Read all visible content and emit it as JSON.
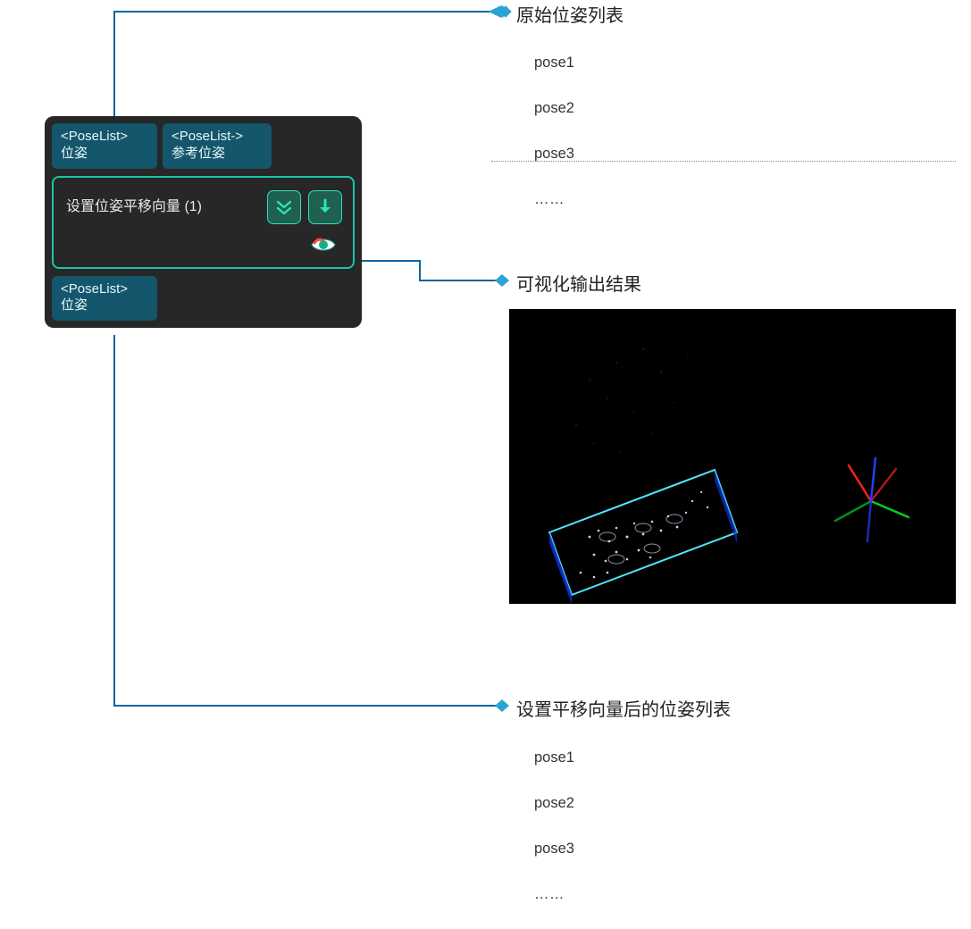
{
  "colors": {
    "node_bg": "#272727",
    "port_bg": "#14566c",
    "node_border": "#19c6a7",
    "accent_button": "#2ee3b5",
    "diamond": "#2ba3d4",
    "connector": "#0a63a0"
  },
  "node": {
    "inputs": [
      {
        "type": "<PoseList>",
        "label": "位姿"
      },
      {
        "type": "<PoseList->",
        "label": "参考位姿"
      }
    ],
    "title": "设置位姿平移向量 (1)",
    "outputs": [
      {
        "type": "<PoseList>",
        "label": "位姿"
      }
    ]
  },
  "icons": {
    "execute": "execute-icon",
    "step": "step-down-icon",
    "visualize": "eye-icon"
  },
  "annotations": {
    "raw": {
      "title": "原始位姿列表",
      "items": [
        "pose1",
        "pose2",
        "pose3",
        "……"
      ]
    },
    "viz": {
      "title": "可视化输出结果"
    },
    "translated": {
      "title": "设置平移向量后的位姿列表",
      "items": [
        "pose1",
        "pose2",
        "pose3",
        "……"
      ]
    }
  }
}
